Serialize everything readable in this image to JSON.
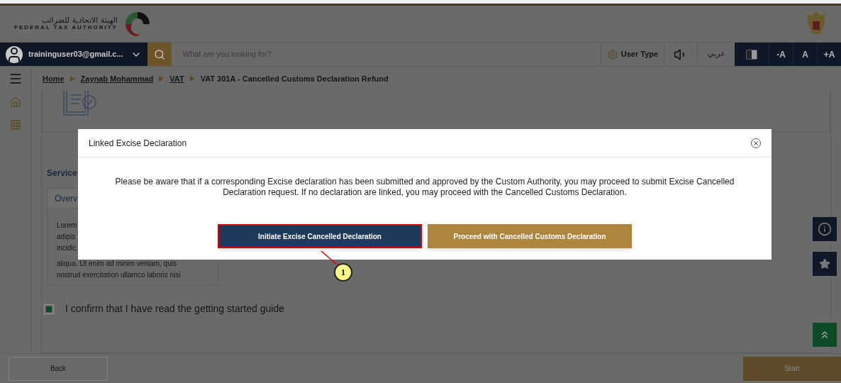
{
  "header": {
    "logo_arabic": "الهيئة الاتحادية للضرائب",
    "logo_english": "FEDERAL TAX AUTHORITY"
  },
  "navbar": {
    "user": "traininguser03@gmail.c...",
    "search_placeholder": "What are you looking for?",
    "user_type": "User Type",
    "language": "عربي",
    "font_buttons": [
      "-A",
      "A",
      "+A"
    ]
  },
  "breadcrumb": [
    {
      "label": "Home",
      "link": true
    },
    {
      "label": "Zaynab Mohammad",
      "link": true
    },
    {
      "label": "VAT",
      "link": true
    },
    {
      "label": "VAT 301A - Cancelled Customs Declaration Refund",
      "link": false
    }
  ],
  "content": {
    "section_title": "Service",
    "tab": "Overv",
    "overview_lines": [
      "Lorem",
      "adipis",
      "incidic"
    ],
    "overview_lines_below": [
      "aliqua. Ut enim ad minim veniam, quis",
      "nostrud exercitation ullamco laboris nisi"
    ],
    "confirm": {
      "label": "I confirm that I have read the getting started guide",
      "checked": true
    }
  },
  "dialog": {
    "title": "Linked Excise Declaration",
    "message": "Please be aware that if a corresponding Excise declaration has been submitted and approved by the Custom Authority, you may proceed to submit Excise Cancelled Declaration request. If no declaration are linked, you may proceed with the Cancelled Customs Declaration.",
    "buttons": [
      {
        "label": "Initiate Excise Cancelled Declaration",
        "kind": "primary",
        "highlighted": true
      },
      {
        "label": "Proceed with Cancelled Customs Declaration",
        "kind": "secondary",
        "highlighted": false
      }
    ]
  },
  "callout": "1",
  "footer": {
    "back": "Back",
    "start": "Start"
  }
}
